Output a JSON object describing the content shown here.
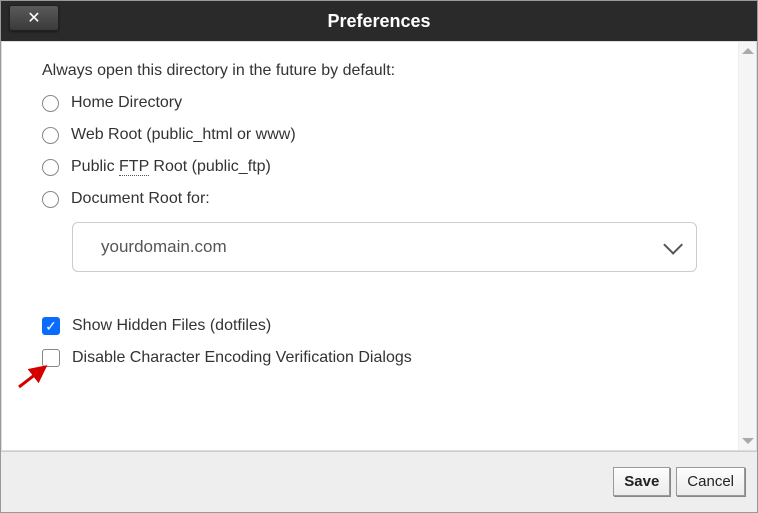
{
  "header": {
    "title": "Preferences"
  },
  "section": {
    "prompt": "Always open this directory in the future by default:"
  },
  "radios": {
    "home": "Home Directory",
    "webroot": "Web Root (public_html or www)",
    "ftp_pre": "Public ",
    "ftp_mid": "FTP",
    "ftp_post": " Root (public_ftp)",
    "docroot": "Document Root for:"
  },
  "select": {
    "value": "yourdomain.com"
  },
  "checks": {
    "hidden": "Show Hidden Files (dotfiles)",
    "encoding": "Disable Character Encoding Verification Dialogs"
  },
  "footer": {
    "save": "Save",
    "cancel": "Cancel"
  }
}
